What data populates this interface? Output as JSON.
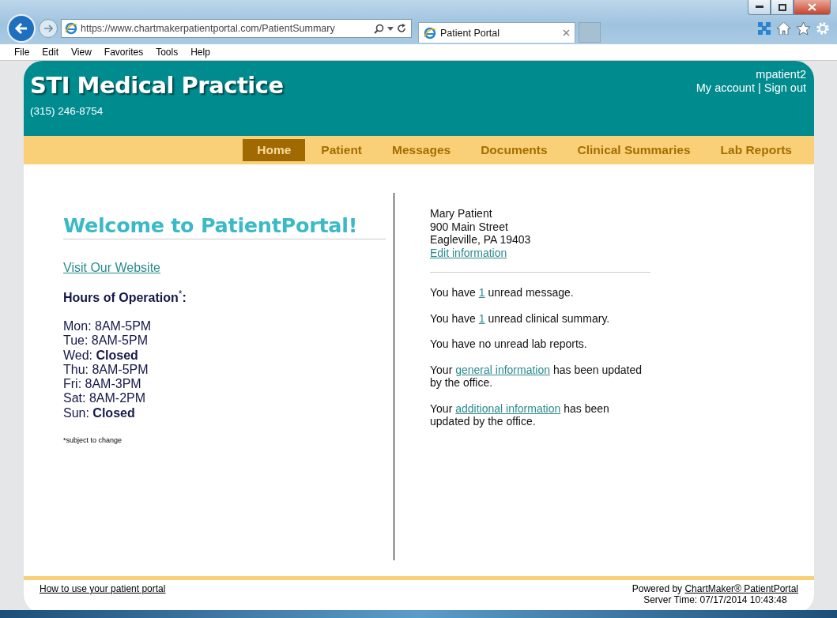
{
  "browser": {
    "address": "https://www.chartmakerpatientportal.com/PatientSummary",
    "tab_title": "Patient Portal",
    "menu": [
      "File",
      "Edit",
      "View",
      "Favorites",
      "Tools",
      "Help"
    ]
  },
  "header": {
    "practice_name": "STI Medical Practice",
    "phone": "(315) 246-8754",
    "username": "mpatient2",
    "account_link": "My account",
    "separator": "|",
    "sign_out_link": "Sign out"
  },
  "nav": [
    {
      "label": "Home",
      "selected": true
    },
    {
      "label": "Patient",
      "selected": false
    },
    {
      "label": "Messages",
      "selected": false
    },
    {
      "label": "Documents",
      "selected": false
    },
    {
      "label": "Clinical Summaries",
      "selected": false
    },
    {
      "label": "Lab Reports",
      "selected": false
    }
  ],
  "welcome": {
    "title": "Welcome to PatientPortal!",
    "website_link": "Visit Our Website",
    "hours_heading": "Hours of Operation$^{*}$:",
    "hours": [
      "Mon: 8AM-5PM",
      "Tue: 8AM-5PM",
      "Wed: **Closed**",
      "Thu: 8AM-5PM",
      "Fri: 8AM-3PM",
      "Sat: 8AM-2PM",
      "Sun: **Closed**"
    ],
    "footnote": "*subject to change"
  },
  "patient": {
    "name": "Mary Patient",
    "street": "900 Main Street",
    "city": "Eagleville, PA 19403",
    "edit_link": "Edit information"
  },
  "notices": [
    {
      "before": "You have ",
      "link": "1",
      "after": " unread message."
    },
    {
      "before": "You have ",
      "link": "1",
      "after": " unread clinical summary."
    },
    {
      "before": "You have no unread lab reports."
    },
    {
      "before": "Your ",
      "link": "general information",
      "after": " has been updated by the office."
    },
    {
      "before": "Your ",
      "link": "additional information",
      "after": " has been updated by the office."
    }
  ],
  "footer": {
    "help_link": "How to use your patient portal",
    "powered_by": "Powered by ",
    "powered_link": "ChartMaker® PatientPortal",
    "server_time": "Server Time: 07/17/2014 10:43:48"
  }
}
